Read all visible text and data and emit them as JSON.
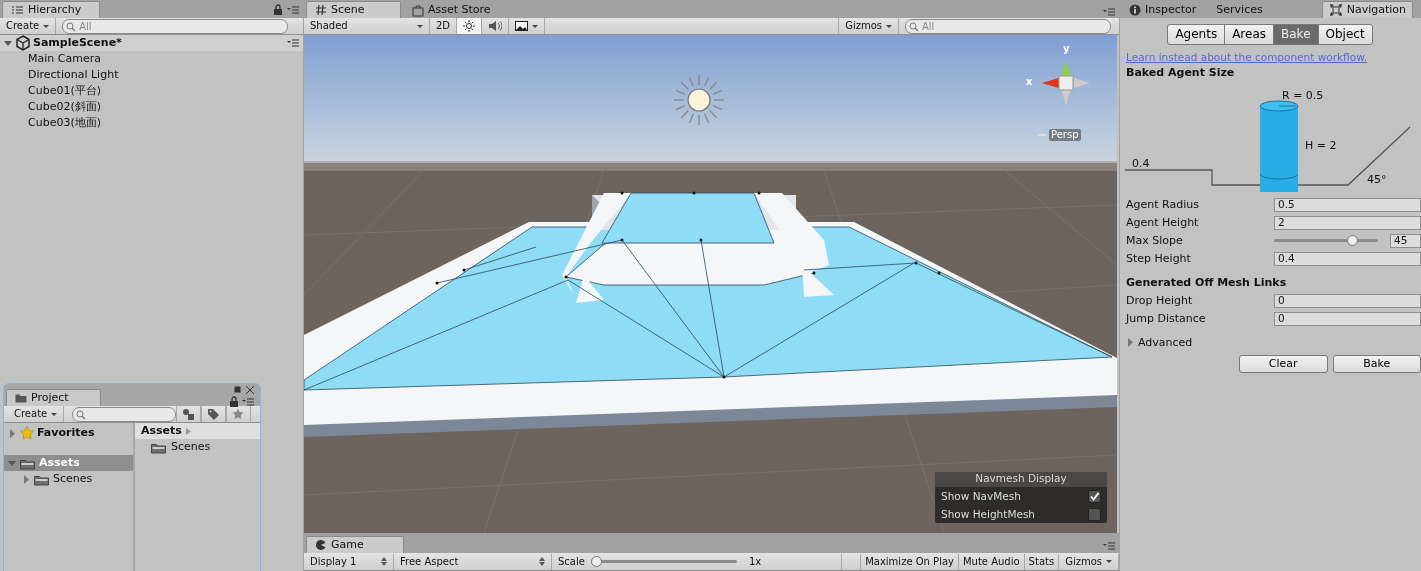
{
  "hierarchy": {
    "tab": "Hierarchy",
    "create": "Create",
    "search_placeholder": "All",
    "scene": {
      "name": "SampleScene*",
      "expanded": true,
      "children": [
        {
          "label": "Main Camera"
        },
        {
          "label": "Directional Light"
        },
        {
          "label": "Cube01(平台)"
        },
        {
          "label": "Cube02(斜面)"
        },
        {
          "label": "Cube03(地面)"
        }
      ]
    }
  },
  "scene_view": {
    "tabs": [
      {
        "label": "Scene",
        "kind": "scene",
        "selected": true
      },
      {
        "label": "Asset Store",
        "kind": "store",
        "selected": false
      }
    ],
    "toolbar": {
      "shading": "Shaded",
      "mode_2d": "2D",
      "lighting_on": true,
      "audio_on": false,
      "gizmos": "Gizmos",
      "search_placeholder": "All"
    },
    "gizmo": {
      "x_label": "x",
      "y_label": "y",
      "projection": "Persp"
    },
    "navmesh_display": {
      "title": "Navmesh Display",
      "options": [
        {
          "label": "Show NavMesh",
          "checked": true
        },
        {
          "label": "Show HeightMesh",
          "checked": false
        }
      ]
    }
  },
  "game_view": {
    "tab": "Game",
    "display": "Display 1",
    "aspect": "Free Aspect",
    "scale_label": "Scale",
    "scale": {
      "level": 0
    },
    "scale_value": "1x",
    "buttons": [
      "Maximize On Play",
      "Mute Audio",
      "Stats"
    ],
    "gizmos": "Gizmos"
  },
  "navigation": {
    "tabs": [
      {
        "label": "Inspector",
        "kind": "inspector",
        "selected": false
      },
      {
        "label": "Services",
        "kind": "services",
        "selected": false
      },
      {
        "label": "Navigation",
        "kind": "navigation",
        "selected": true
      }
    ],
    "modes": [
      {
        "label": "Agents",
        "selected": false
      },
      {
        "label": "Areas",
        "selected": false
      },
      {
        "label": "Bake",
        "selected": true
      },
      {
        "label": "Object",
        "selected": false
      }
    ],
    "link": "Learn instead about the component workflow.",
    "agent_size_title": "Baked Agent Size",
    "diagram": {
      "radius": "R = 0.5",
      "height": "H = 2",
      "step": "0.4",
      "slope": "45°"
    },
    "fields": [
      {
        "label": "Agent Radius",
        "value": "0.5",
        "kind": "text"
      },
      {
        "label": "Agent Height",
        "value": "2",
        "kind": "text"
      },
      {
        "label": "Max Slope",
        "value": "45",
        "kind": "slider",
        "level": 0.75
      },
      {
        "label": "Step Height",
        "value": "0.4",
        "kind": "text"
      }
    ],
    "offmesh_title": "Generated Off Mesh Links",
    "offmesh_fields": [
      {
        "label": "Drop Height",
        "value": "0"
      },
      {
        "label": "Jump Distance",
        "value": "0"
      }
    ],
    "advanced": {
      "label": "Advanced",
      "expanded": false
    },
    "buttons": [
      "Clear",
      "Bake"
    ]
  },
  "project": {
    "tab": "Project",
    "create": "Create",
    "tree": [
      {
        "label": "Favorites",
        "kind": "favorites",
        "selected": false,
        "expanded": false
      },
      {
        "label": "Assets",
        "kind": "folder",
        "selected": true,
        "expanded": true,
        "children": [
          {
            "label": "Scenes",
            "kind": "folder",
            "selected": false,
            "expanded": false
          }
        ]
      }
    ],
    "breadcrumb": "Assets",
    "items": [
      {
        "label": "Scenes"
      }
    ]
  }
}
